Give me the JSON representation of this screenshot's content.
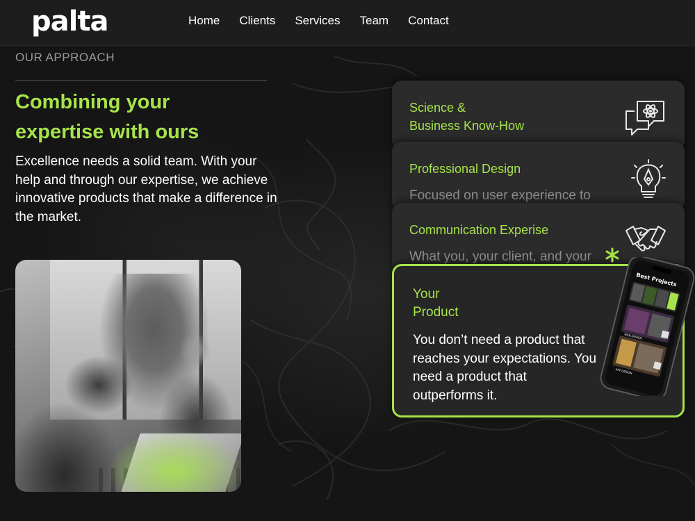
{
  "brand": {
    "logo": "palta",
    "accent": "#a6e34a"
  },
  "nav": {
    "items": [
      {
        "label": "Home"
      },
      {
        "label": "Clients"
      },
      {
        "label": "Services"
      },
      {
        "label": "Team"
      },
      {
        "label": "Contact"
      }
    ]
  },
  "approach": {
    "eyebrow": "OUR APPROACH",
    "headline_line1": "Combining your",
    "headline_line2": "expertise with ours",
    "intro": "Excellence needs a solid team. With your help and through our expertise, we achieve innovative products that make a difference in the market."
  },
  "cards": [
    {
      "title_line1": "Science &",
      "title_line2": "Business Know-How",
      "icon": "chat-atom-icon"
    },
    {
      "title": "Professional Design",
      "desc": "Focused on user experience to",
      "icon": "pen-bulb-icon"
    },
    {
      "title": "Communication Experise",
      "desc": "What you, your client, and your",
      "icon": "handshake-icon"
    },
    {
      "title_line1": "Your",
      "title_line2": "Product",
      "body": "You don’t need a product that reaches your expectations. You need a product that outperforms it."
    }
  ],
  "phone": {
    "heading": "Best Projects",
    "tags": [
      "WEB DESIGN",
      "APP DESIGN"
    ]
  }
}
